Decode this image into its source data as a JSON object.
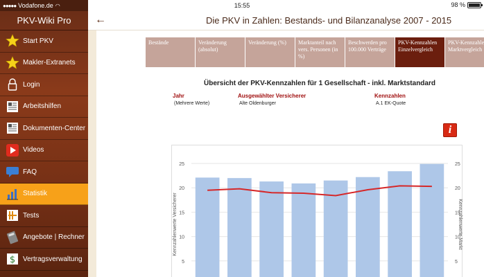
{
  "status": {
    "carrier": "Vodafone.de",
    "time": "15:55",
    "battery": "98 %"
  },
  "sidebar": {
    "title": "PKV-Wiki Pro",
    "items": [
      {
        "label": "Start PKV",
        "icon": "star-icon"
      },
      {
        "label": "Makler-Extranets",
        "icon": "star-icon"
      },
      {
        "label": "Login",
        "icon": "lock-icon"
      },
      {
        "label": "Arbeitshilfen",
        "icon": "document-icon"
      },
      {
        "label": "Dokumenten-Center",
        "icon": "document-icon"
      },
      {
        "label": "Videos",
        "icon": "play-icon"
      },
      {
        "label": "FAQ",
        "icon": "speech-bubble-icon"
      },
      {
        "label": "Statistik",
        "icon": "statistics-icon",
        "active": true
      },
      {
        "label": "Tests",
        "icon": "tests-icon"
      },
      {
        "label": "Angebote | Rechner",
        "icon": "calculator-icon"
      },
      {
        "label": "Vertragsverwaltung",
        "icon": "dollar-icon"
      }
    ]
  },
  "header": {
    "back": "←",
    "title": "Die PKV in Zahlen: Bestands- und Bilanzanalyse 2007 - 2015"
  },
  "tabs": [
    "Bestände",
    "Veränderung (absolut)",
    "Veränderung (%)",
    "Marktanteil nach vers. Personen (in %)",
    "Beschwerden pro 100.000 Verträge",
    "PKV-Kennzahlen Einzelvergleich",
    "PKV-Kennzahlen Marktvergleich"
  ],
  "active_tab": 5,
  "report": {
    "title": "Übersicht der PKV-Kennzahlen für 1 Gesellschaft - inkl. Marktstandard",
    "year_label": "Jahr",
    "year_value": "(Mehrere Werte)",
    "insurer_label": "Ausgewählter Versicherer",
    "insurer_value": "Alte Oldenburger",
    "metric_label": "Kennzahlen",
    "metric_value": "A.1 EK-Quote",
    "info_symbol": "i"
  },
  "colors": {
    "bar": "#aec7e8",
    "line": "#d62728"
  },
  "chart_data": {
    "type": "bar",
    "categories": [
      "",
      "",
      "",
      "",
      "",
      "",
      "",
      ""
    ],
    "ylabel": "Kennzahlenwerte Versicherer",
    "y2label": "Kennzahlenwerte Markt",
    "ylim": [
      0,
      25
    ],
    "yticks": [
      0,
      5,
      10,
      15,
      20,
      25
    ],
    "grid": true,
    "series": [
      {
        "type": "bar",
        "values": [
          22.1,
          22.0,
          21.3,
          20.9,
          21.5,
          22.2,
          23.4,
          24.9
        ]
      },
      {
        "type": "line",
        "values": [
          19.5,
          19.8,
          19.0,
          18.9,
          18.4,
          19.6,
          20.4,
          20.3
        ]
      }
    ]
  }
}
